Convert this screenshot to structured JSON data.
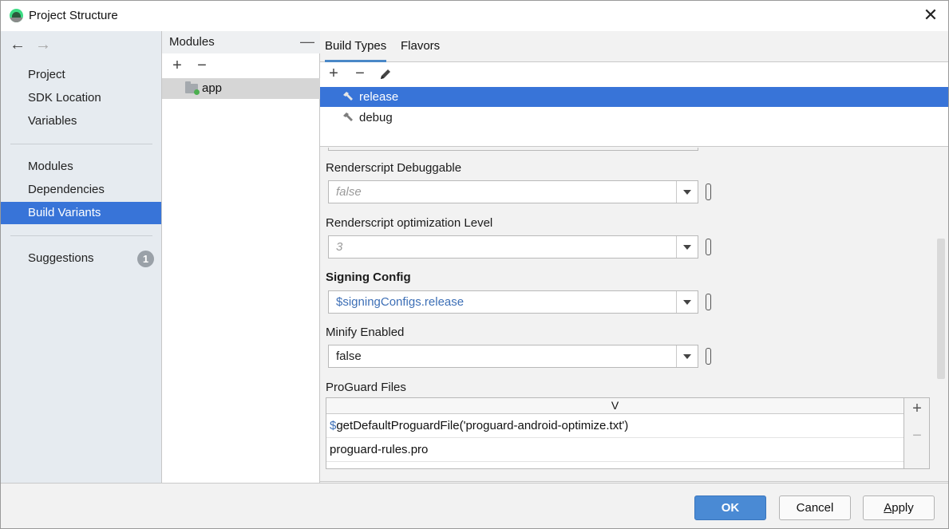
{
  "window": {
    "title": "Project Structure",
    "close_glyph": "✕"
  },
  "nav": {
    "back_glyph": "←",
    "forward_glyph": "→",
    "items": [
      {
        "label": "Project"
      },
      {
        "label": "SDK Location"
      },
      {
        "label": "Variables"
      },
      {
        "label": "Modules"
      },
      {
        "label": "Dependencies"
      },
      {
        "label": "Build Variants",
        "selected": true
      },
      {
        "label": "Suggestions",
        "badge": "1"
      }
    ]
  },
  "modules": {
    "header": "Modules",
    "collapse_glyph": "—",
    "add_glyph": "+",
    "remove_glyph": "−",
    "items": [
      {
        "label": "app"
      }
    ]
  },
  "right": {
    "tabs": [
      {
        "label": "Build Types",
        "active": true
      },
      {
        "label": "Flavors"
      }
    ],
    "toolbar": {
      "add_glyph": "+",
      "remove_glyph": "−",
      "edit_icon": "pencil-icon"
    },
    "build_types": [
      {
        "label": "release",
        "selected": true,
        "icon": "hammer-icon"
      },
      {
        "label": "debug",
        "icon": "hammer-icon"
      }
    ],
    "properties": [
      {
        "label": "Renderscript Debuggable",
        "value": "false",
        "style": "placeholder"
      },
      {
        "label": "Renderscript optimization Level",
        "value": "3",
        "style": "placeholder"
      },
      {
        "label": "Signing Config",
        "value": "$signingConfigs.release",
        "style": "link",
        "bold": true
      },
      {
        "label": "Minify Enabled",
        "value": "false",
        "style": "normal"
      }
    ],
    "proguard": {
      "label": "ProGuard Files",
      "column_header": "V",
      "rows": [
        {
          "prefix": "$",
          "text": "getDefaultProguardFile('proguard-android-optimize.txt')"
        },
        {
          "prefix": "",
          "text": "proguard-rules.pro"
        }
      ],
      "add_glyph": "+",
      "remove_glyph": "−"
    }
  },
  "footer": {
    "ok_label": "OK",
    "cancel_label": "Cancel",
    "apply_label_first": "A",
    "apply_label_rest": "pply"
  },
  "colors": {
    "selection": "#3874d8",
    "primary_button": "#4a8ad4",
    "link_text": "#3d6fb6",
    "nav_background": "#e6ebf0"
  }
}
